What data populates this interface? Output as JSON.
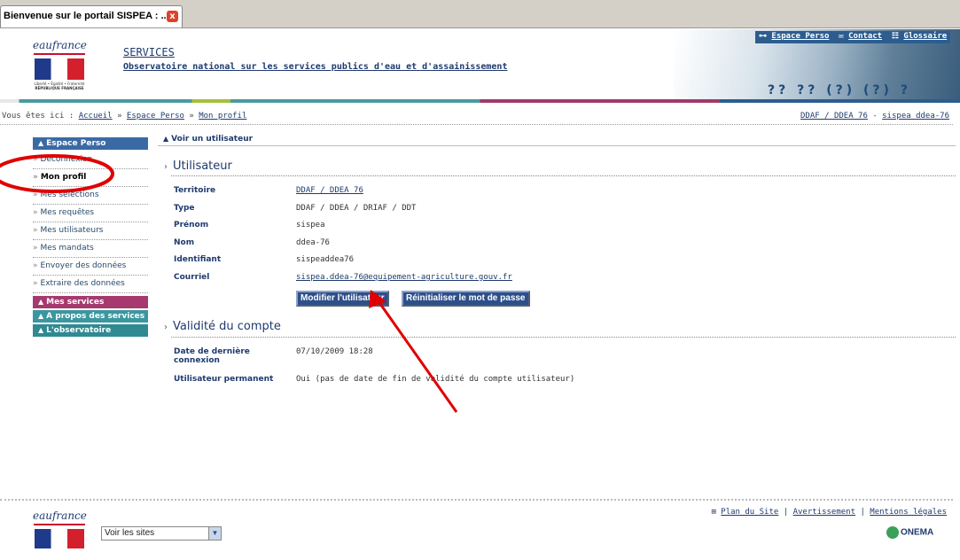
{
  "browser": {
    "tab_title": "Bienvenue sur le portail SISPEA : ...",
    "close_label": "x"
  },
  "header": {
    "logo_text": "eaufrance",
    "logo_caption": "Liberté • Égalité • Fraternité",
    "logo_rep": "RÉPUBLIQUE FRANÇAISE",
    "title": "SERVICES",
    "subtitle": "Observatoire national sur les services publics d'eau et d'assainissement",
    "toplinks": {
      "espace_perso": "Espace Perso",
      "contact": "Contact",
      "glossaire": "Glossaire"
    },
    "icons_text": "?? ?? (?) (?) ?"
  },
  "breadcrumb": {
    "prefix": "Vous êtes ici :",
    "items": [
      "Accueil",
      "Espace Perso",
      "Mon profil"
    ],
    "sep": "»",
    "user_org": "DDAF / DDEA 76",
    "user_dash": "-",
    "user_name": "sispea ddea-76"
  },
  "sidebar": {
    "espace_perso": "Espace Perso",
    "items": [
      "Déconnexion",
      "Mon profil",
      "Mes sélections",
      "Mes requêtes",
      "Mes utilisateurs",
      "Mes mandats",
      "Envoyer des données",
      "Extraire des données"
    ],
    "mes_services": "Mes services",
    "a_propos": "A propos des services",
    "observatoire": "L'observatoire"
  },
  "content": {
    "title": "Voir un utilisateur",
    "section1": "Utilisateur",
    "fields": [
      {
        "label": "Territoire",
        "value": "DDAF / DDEA 76"
      },
      {
        "label": "Type",
        "value": "DDAF / DDEA / DRIAF / DDT"
      },
      {
        "label": "Prénom",
        "value": "sispea"
      },
      {
        "label": "Nom",
        "value": "ddea-76"
      },
      {
        "label": "Identifiant",
        "value": "sispeaddea76"
      },
      {
        "label": "Courriel",
        "value": "sispea.ddea-76@equipement-agriculture.gouv.fr"
      }
    ],
    "btn_modify": "Modifier l'utilisateur",
    "btn_reset": "Réinitialiser le mot de passe",
    "section2": "Validité du compte",
    "last_login_label": "Date de dernière connexion",
    "last_login_value": "07/10/2009 18:28",
    "permanent_label": "Utilisateur permanent",
    "permanent_value": "Oui (pas de date de fin de validité du compte utilisateur)"
  },
  "footer": {
    "logo_text": "eaufrance",
    "select_value": "Voir les sites",
    "plan": "Plan du Site",
    "avertissement": "Avertissement",
    "mentions": "Mentions légales",
    "sep": "|",
    "onema": "ONEMA"
  },
  "colors": {
    "nav_blue": "#3a6aa5",
    "nav_pink": "#a63a6e",
    "nav_teal": "#3a97a0",
    "annotation_red": "#e00000"
  }
}
